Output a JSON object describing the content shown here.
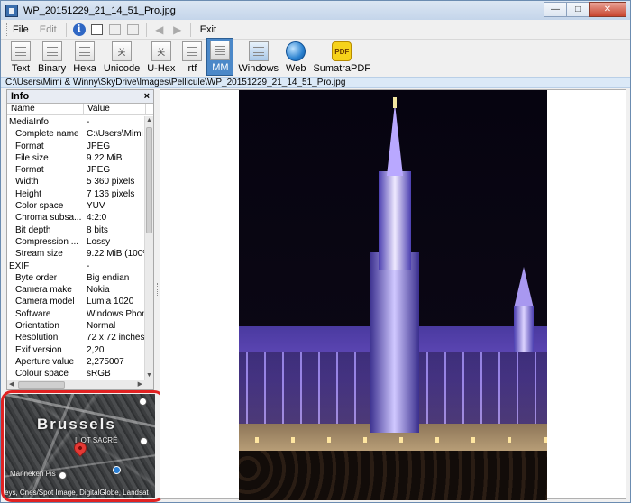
{
  "window": {
    "title": "WP_20151229_21_14_51_Pro.jpg",
    "minimize": "—",
    "maximize": "□",
    "close": "✕"
  },
  "menu": {
    "file": "File",
    "edit": "Edit",
    "exit": "Exit",
    "info_icon_glyph": "i"
  },
  "toolbar": {
    "items": [
      {
        "label": "Text",
        "icon": "text-view-icon"
      },
      {
        "label": "Binary",
        "icon": "binary-view-icon"
      },
      {
        "label": "Hexa",
        "icon": "hex-view-icon"
      },
      {
        "label": "Unicode",
        "icon": "unicode-view-icon",
        "glyph": "关"
      },
      {
        "label": "U-Hex",
        "icon": "unicode-hex-view-icon",
        "glyph": "关"
      },
      {
        "label": "rtf",
        "icon": "rtf-view-icon"
      },
      {
        "label": "MM",
        "icon": "multimedia-view-icon"
      },
      {
        "label": "Windows",
        "icon": "windows-view-icon"
      },
      {
        "label": "Web",
        "icon": "web-globe-icon"
      },
      {
        "label": "SumatraPDF",
        "icon": "sumatra-pdf-icon",
        "glyph": "PDF"
      }
    ],
    "active": "MM"
  },
  "path": "C:\\Users\\Mimi & Winny\\SkyDrive\\Images\\Pellicule\\WP_20151229_21_14_51_Pro.jpg",
  "info_panel": {
    "title": "Info",
    "close": "×",
    "col_name": "Name",
    "col_value": "Value",
    "rows": [
      {
        "name": "MediaInfo",
        "value": "-",
        "section": true
      },
      {
        "name": "Complete name",
        "value": "C:\\Users\\Mimi"
      },
      {
        "name": "Format",
        "value": "JPEG"
      },
      {
        "name": "File size",
        "value": "9.22 MiB"
      },
      {
        "name": "Format",
        "value": "JPEG"
      },
      {
        "name": "Width",
        "value": "5 360 pixels"
      },
      {
        "name": "Height",
        "value": "7 136 pixels"
      },
      {
        "name": "Color space",
        "value": "YUV"
      },
      {
        "name": "Chroma subsa...",
        "value": "4:2:0"
      },
      {
        "name": "Bit depth",
        "value": "8 bits"
      },
      {
        "name": "Compression ...",
        "value": "Lossy"
      },
      {
        "name": "Stream size",
        "value": "9.22 MiB (100%"
      },
      {
        "name": "EXIF",
        "value": "-",
        "section": true
      },
      {
        "name": "Byte order",
        "value": "Big endian"
      },
      {
        "name": "Camera make",
        "value": "Nokia"
      },
      {
        "name": "Camera model",
        "value": "Lumia 1020"
      },
      {
        "name": "Software",
        "value": "Windows Phon"
      },
      {
        "name": "Orientation",
        "value": "Normal"
      },
      {
        "name": "Resolution",
        "value": "72 x 72 inches"
      },
      {
        "name": "Exif version",
        "value": "2,20"
      },
      {
        "name": "Aperture value",
        "value": "2,275007"
      },
      {
        "name": "Colour space",
        "value": "sRGB"
      }
    ]
  },
  "map": {
    "city": "Brussels",
    "district": "ILOT SACRÉ",
    "poi": "Manneken Pis",
    "attribution": "eys, Cnes/Spot Image, DigitalGlobe, Landsat"
  }
}
